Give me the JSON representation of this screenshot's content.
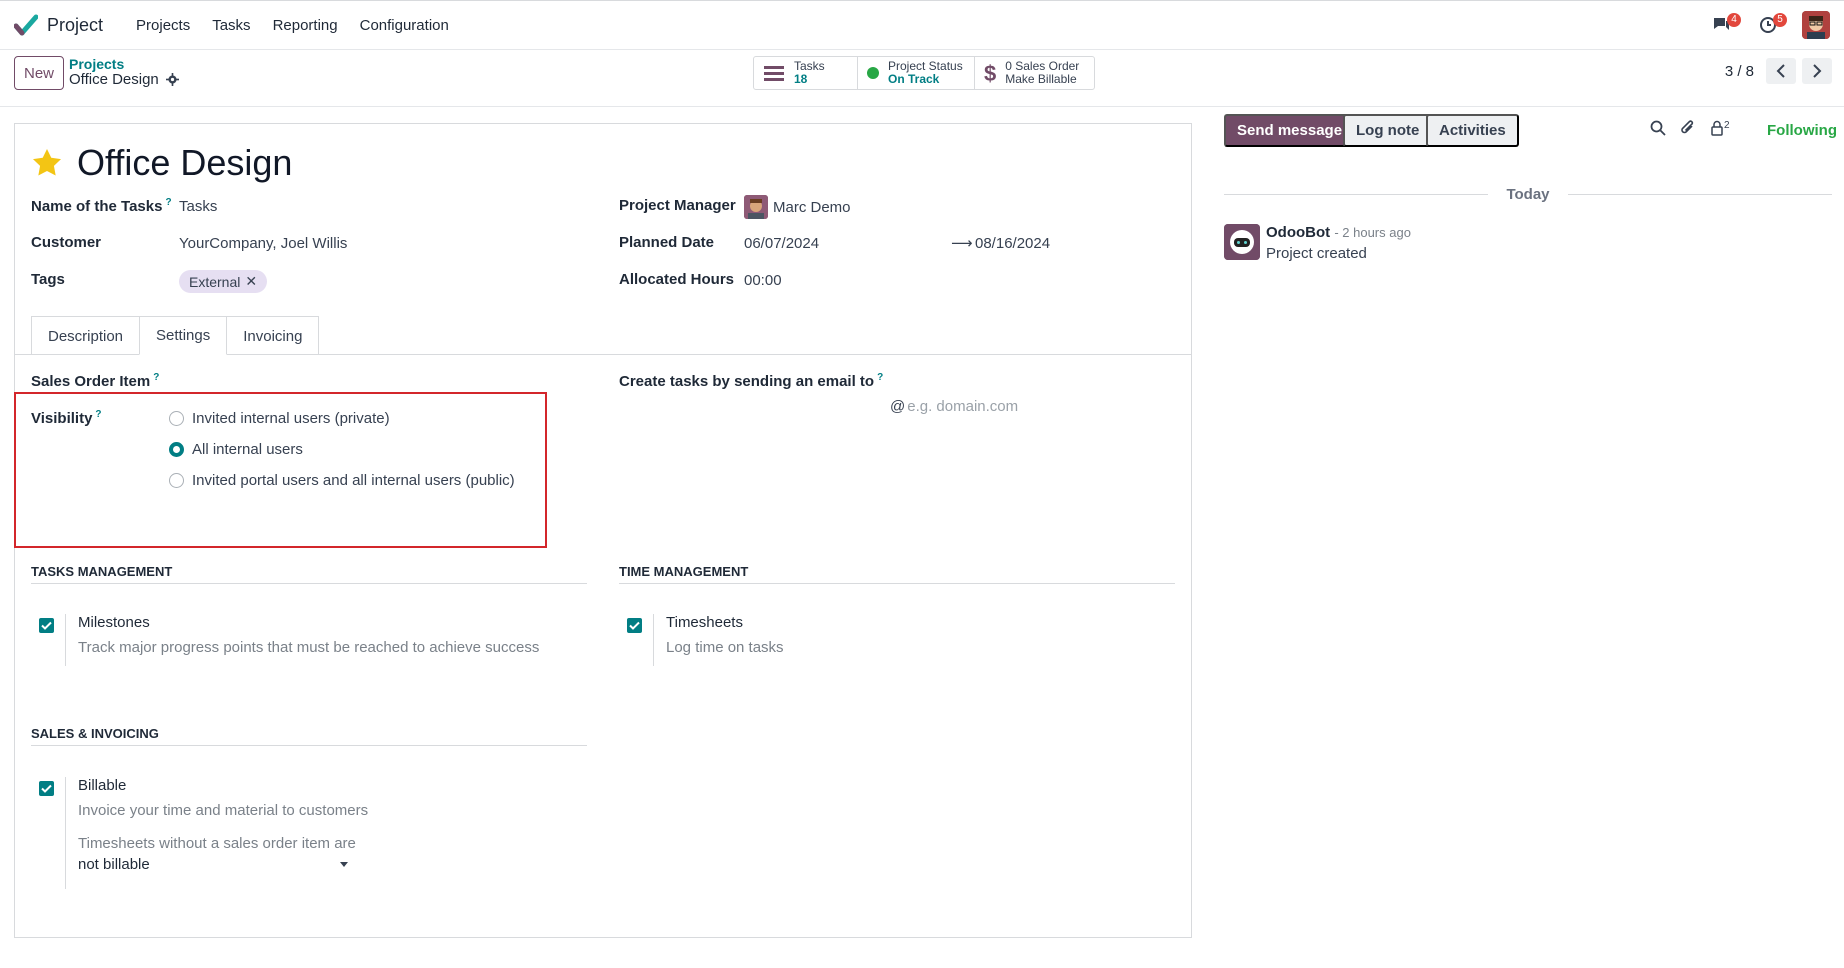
{
  "app": {
    "name": "Project"
  },
  "nav": {
    "items": [
      "Projects",
      "Tasks",
      "Reporting",
      "Configuration"
    ]
  },
  "systray": {
    "messages_count": "4",
    "activities_count": "5"
  },
  "control": {
    "new_label": "New",
    "breadcrumb_parent": "Projects",
    "breadcrumb_current": "Office Design",
    "stats": [
      {
        "label": "Tasks",
        "value": "18",
        "icon": "tasks-icon"
      },
      {
        "label": "Project Status",
        "value": "On Track",
        "icon": "status-dot-icon"
      },
      {
        "label": "0 Sales Order",
        "value": "Make Billable",
        "icon": "dollar-icon"
      }
    ],
    "pager": "3 / 8"
  },
  "form": {
    "title": "Office Design",
    "fields": {
      "name_of_tasks_label": "Name of the Tasks",
      "name_of_tasks_value": "Tasks",
      "customer_label": "Customer",
      "customer_value": "YourCompany, Joel Willis",
      "tags_label": "Tags",
      "tag_value": "External",
      "project_manager_label": "Project Manager",
      "project_manager_value": "Marc Demo",
      "planned_date_label": "Planned Date",
      "planned_date_start": "06/07/2024",
      "planned_date_end": "08/16/2024",
      "allocated_hours_label": "Allocated Hours",
      "allocated_hours_value": "00:00"
    },
    "tabs": [
      "Description",
      "Settings",
      "Invoicing"
    ],
    "active_tab": "Settings",
    "settings": {
      "sales_order_item_label": "Sales Order Item",
      "visibility_label": "Visibility",
      "visibility_options": [
        "Invited internal users (private)",
        "All internal users",
        "Invited portal users and all internal users (public)"
      ],
      "visibility_selected": "All internal users",
      "email_label": "Create tasks by sending an email to",
      "email_at": "@",
      "email_placeholder": "e.g. domain.com",
      "tasks_management_title": "TASKS MANAGEMENT",
      "time_management_title": "TIME MANAGEMENT",
      "sales_invoicing_title": "SALES & INVOICING",
      "milestones_title": "Milestones",
      "milestones_desc": "Track major progress points that must be reached to achieve success",
      "milestones_checked": true,
      "timesheets_title": "Timesheets",
      "timesheets_desc": "Log time on tasks",
      "timesheets_checked": true,
      "billable_title": "Billable",
      "billable_desc": "Invoice your time and material to customers",
      "billable_checked": true,
      "timesheets_without_so_label": "Timesheets without a sales order item are",
      "timesheets_without_so_value": "not billable"
    }
  },
  "chatter": {
    "send_message": "Send message",
    "log_note": "Log note",
    "activities": "Activities",
    "followers_count": "2",
    "following": "Following",
    "date_separator": "Today",
    "messages": [
      {
        "author": "OdooBot",
        "time": "- 2 hours ago",
        "body": "Project created"
      }
    ]
  },
  "colors": {
    "brand": "#714b67",
    "accent": "#017e84",
    "highlight": "#d3262b",
    "following": "#28a745"
  }
}
